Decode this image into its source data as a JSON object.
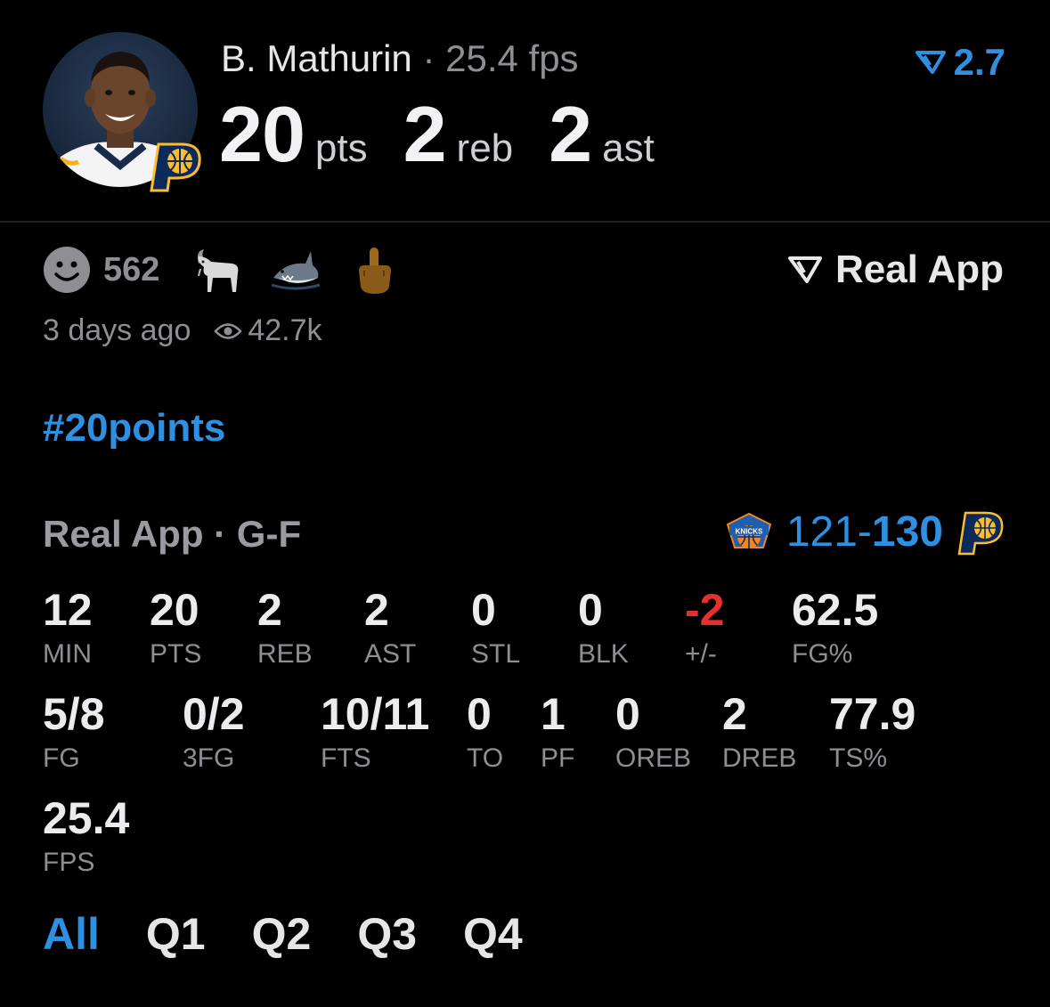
{
  "header": {
    "player_name": "B. Mathurin",
    "separator": "·",
    "fps_text": "25.4 fps",
    "pts": "20",
    "pts_unit": "pts",
    "reb": "2",
    "reb_unit": "reb",
    "ast": "2",
    "ast_unit": "ast",
    "rating": "2.7",
    "avatar_icon": "player-headshot",
    "team_icon": "pacers-logo"
  },
  "reactions": {
    "count": "562",
    "emojis": [
      "goat",
      "shark",
      "middle-finger"
    ]
  },
  "source": {
    "label": "Real App"
  },
  "meta": {
    "time_ago": "3 days ago",
    "views": "42.7k"
  },
  "hashtag": "#20points",
  "panel": {
    "title": "Real App · G-F",
    "away_score": "121",
    "dash": "-",
    "home_score": "130",
    "away_team_icon": "knicks-logo",
    "home_team_icon": "pacers-logo"
  },
  "stats_row1": [
    {
      "value": "12",
      "label": "MIN"
    },
    {
      "value": "20",
      "label": "PTS"
    },
    {
      "value": "2",
      "label": "REB"
    },
    {
      "value": "2",
      "label": "AST"
    },
    {
      "value": "0",
      "label": "STL"
    },
    {
      "value": "0",
      "label": "BLK"
    },
    {
      "value": "-2",
      "label": "+/-"
    },
    {
      "value": "62.5",
      "label": "FG%"
    }
  ],
  "stats_row2": [
    {
      "value": "5/8",
      "label": "FG"
    },
    {
      "value": "0/2",
      "label": "3FG"
    },
    {
      "value": "10/11",
      "label": "FTS"
    },
    {
      "value": "0",
      "label": "TO"
    },
    {
      "value": "1",
      "label": "PF"
    },
    {
      "value": "0",
      "label": "OREB"
    },
    {
      "value": "2",
      "label": "DREB"
    },
    {
      "value": "77.9",
      "label": "TS%"
    }
  ],
  "stats_row3": [
    {
      "value": "25.4",
      "label": "FPS"
    }
  ],
  "tabs": [
    "All",
    "Q1",
    "Q2",
    "Q3",
    "Q4"
  ],
  "colors": {
    "accent": "#2f8fe0",
    "negative": "#e5302b",
    "muted": "#8e8e93",
    "background": "#000000"
  }
}
